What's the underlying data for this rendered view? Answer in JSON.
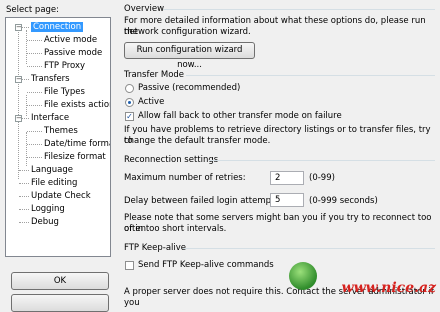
{
  "left": {
    "select_label": "Select page:",
    "tree": [
      {
        "label": "Connection",
        "level": 0,
        "selected": true
      },
      {
        "label": "Active mode",
        "level": 1
      },
      {
        "label": "Passive mode",
        "level": 1
      },
      {
        "label": "FTP Proxy",
        "level": 1
      },
      {
        "label": "Transfers",
        "level": 0
      },
      {
        "label": "File Types",
        "level": 1
      },
      {
        "label": "File exists action",
        "level": 1
      },
      {
        "label": "Interface",
        "level": 0
      },
      {
        "label": "Themes",
        "level": 1
      },
      {
        "label": "Date/time format",
        "level": 1
      },
      {
        "label": "Filesize format",
        "level": 1
      },
      {
        "label": "Language",
        "level": 0
      },
      {
        "label": "File editing",
        "level": 0
      },
      {
        "label": "Update Check",
        "level": 0
      },
      {
        "label": "Logging",
        "level": 0
      },
      {
        "label": "Debug",
        "level": 0
      }
    ],
    "ok_label": "OK"
  },
  "overview": {
    "heading": "Overview",
    "text1": "For more detailed information about what these options do, please run the",
    "text2": "network configuration wizard.",
    "wizard_button": "Run configuration wizard now..."
  },
  "transfer_mode": {
    "heading": "Transfer Mode",
    "passive_label": "Passive (recommended)",
    "active_label": "Active",
    "fallback_label": "Allow fall back to other transfer mode on failure",
    "note1": "If you have problems to retrieve directory listings or to transfer files, try to",
    "note2": "change the default transfer mode."
  },
  "reconnection": {
    "heading": "Reconnection settings",
    "retries_label": "Maximum number of retries:",
    "retries_value": "2",
    "retries_range": "(0-99)",
    "delay_label": "Delay between failed login attempts:",
    "delay_value": "5",
    "delay_range": "(0-999 seconds)",
    "note1": "Please note that some servers might ban you if you try to reconnect too often",
    "note2": "or in too short intervals."
  },
  "keepalive": {
    "heading": "FTP Keep-alive",
    "check_label": "Send FTP Keep-alive commands",
    "note": "A proper server does not require this. Contact the server administrator if you"
  },
  "watermark": "www.nice.az",
  "colors": {
    "selection": "#3399ff",
    "watermark": "#d6221e"
  }
}
